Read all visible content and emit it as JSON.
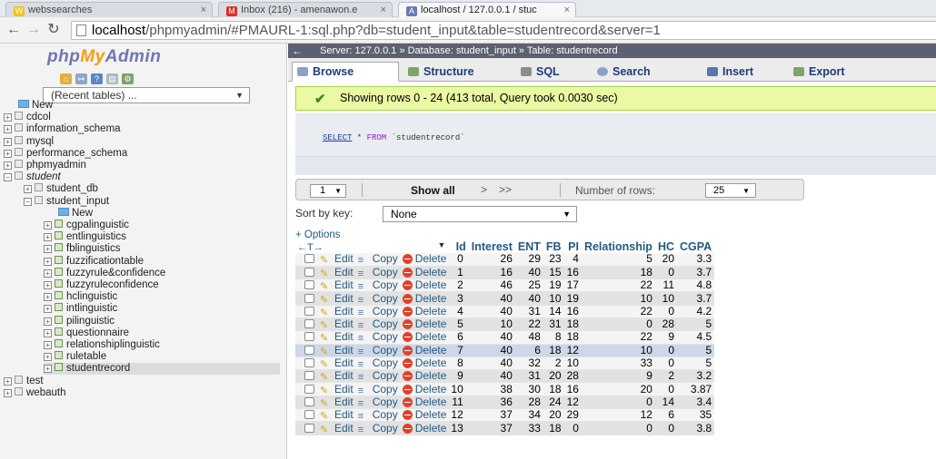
{
  "browser": {
    "tabs": [
      {
        "icon": "W",
        "icon_color": "#f2c417",
        "title": "webssearches"
      },
      {
        "icon": "M",
        "icon_color": "#d93025",
        "title": "Inbox (216) - amenawon.e"
      },
      {
        "icon": "A",
        "icon_color": "#6c78af",
        "title": "localhost / 127.0.0.1 / stuc"
      }
    ],
    "close_glyph": "×",
    "url_host": "localhost",
    "url_rest": "/phpmyadmin/#PMAURL-1:sql.php?db=student_input&table=studentrecord&server=1"
  },
  "sidebar": {
    "logo_php": "php",
    "logo_my": "My",
    "logo_admin": "Admin",
    "recent_tables": "(Recent tables) ...",
    "tree": [
      {
        "label": "New",
        "kind": "new",
        "level": 0
      },
      {
        "label": "cdcol",
        "kind": "db",
        "level": 0
      },
      {
        "label": "information_schema",
        "kind": "db",
        "level": 0
      },
      {
        "label": "mysql",
        "kind": "db",
        "level": 0
      },
      {
        "label": "performance_schema",
        "kind": "db",
        "level": 0
      },
      {
        "label": "phpmyadmin",
        "kind": "db",
        "level": 0
      },
      {
        "label": "student",
        "kind": "group",
        "level": 0
      },
      {
        "label": "student_db",
        "kind": "db",
        "level": 1
      },
      {
        "label": "student_input",
        "kind": "db",
        "level": 1
      },
      {
        "label": "New",
        "kind": "new",
        "level": 2
      },
      {
        "label": "cgpalinguistic",
        "kind": "table",
        "level": 2
      },
      {
        "label": "entlinguistics",
        "kind": "table",
        "level": 2
      },
      {
        "label": "fblinguistics",
        "kind": "table",
        "level": 2
      },
      {
        "label": "fuzzificationtable",
        "kind": "table",
        "level": 2
      },
      {
        "label": "fuzzyrule&confidence",
        "kind": "table",
        "level": 2
      },
      {
        "label": "fuzzyruleconfidence",
        "kind": "table",
        "level": 2
      },
      {
        "label": "hclinguistic",
        "kind": "table",
        "level": 2
      },
      {
        "label": "intlinguistic",
        "kind": "table",
        "level": 2
      },
      {
        "label": "pilinguistic",
        "kind": "table",
        "level": 2
      },
      {
        "label": "questionnaire",
        "kind": "table",
        "level": 2
      },
      {
        "label": "relationshiplinguistic",
        "kind": "table",
        "level": 2
      },
      {
        "label": "ruletable",
        "kind": "table",
        "level": 2
      },
      {
        "label": "studentrecord",
        "kind": "table",
        "level": 2,
        "selected": true
      },
      {
        "label": "test",
        "kind": "db",
        "level": 0
      },
      {
        "label": "webauth",
        "kind": "db",
        "level": 0
      }
    ]
  },
  "breadcrumb": {
    "back": "←",
    "text": "Server: 127.0.0.1 » Database: student_input » Table: studentrecord"
  },
  "tabs": [
    {
      "label": "Browse",
      "icon_color": "#8aa2c9",
      "active": true
    },
    {
      "label": "Structure",
      "icon_color": "#7fa36a"
    },
    {
      "label": "SQL",
      "icon_color": "#8c8c8c"
    },
    {
      "label": "Search",
      "icon_color": "#8aa2c9"
    },
    {
      "label": "Insert",
      "icon_color": "#5577aa"
    },
    {
      "label": "Export",
      "icon_color": "#7fa36a"
    }
  ],
  "message": {
    "check": "✔",
    "text": "Showing rows 0 - 24 (413 total, Query took 0.0030 sec)"
  },
  "query": {
    "select_kw": "SELECT",
    "star": " * ",
    "from_kw": "FROM",
    "table": " `studentrecord`"
  },
  "navigation": {
    "page": "1",
    "show_all": "Show all",
    "next": ">",
    "last": ">>",
    "rows_label": "Number of rows:",
    "rows_value": "25"
  },
  "sort": {
    "label": "Sort by key:",
    "value": "None"
  },
  "options_label": "+ Options",
  "resize_glyph": "←T→",
  "actions": {
    "edit": "Edit",
    "copy": "Copy",
    "delete": "Delete"
  },
  "table": {
    "columns": [
      "Id",
      "Interest",
      "ENT",
      "FB",
      "PI",
      "Relationship",
      "HC",
      "CGPA"
    ],
    "rows": [
      [
        "0",
        "26",
        "29",
        "23",
        "4",
        "5",
        "20",
        "3.3"
      ],
      [
        "1",
        "16",
        "40",
        "15",
        "16",
        "18",
        "0",
        "3.7"
      ],
      [
        "2",
        "46",
        "25",
        "19",
        "17",
        "22",
        "11",
        "4.8"
      ],
      [
        "3",
        "40",
        "40",
        "10",
        "19",
        "10",
        "10",
        "3.7"
      ],
      [
        "4",
        "40",
        "31",
        "14",
        "16",
        "22",
        "0",
        "4.2"
      ],
      [
        "5",
        "10",
        "22",
        "31",
        "18",
        "0",
        "28",
        "5"
      ],
      [
        "6",
        "40",
        "48",
        "8",
        "18",
        "22",
        "9",
        "4.5"
      ],
      [
        "7",
        "40",
        "6",
        "18",
        "12",
        "10",
        "0",
        "5"
      ],
      [
        "8",
        "40",
        "32",
        "2",
        "10",
        "33",
        "0",
        "5"
      ],
      [
        "9",
        "40",
        "31",
        "20",
        "28",
        "9",
        "2",
        "3.2"
      ],
      [
        "10",
        "38",
        "30",
        "18",
        "16",
        "20",
        "0",
        "3.87"
      ],
      [
        "11",
        "36",
        "28",
        "24",
        "12",
        "0",
        "14",
        "3.4"
      ],
      [
        "12",
        "37",
        "34",
        "20",
        "29",
        "12",
        "6",
        "35"
      ],
      [
        "13",
        "37",
        "33",
        "18",
        "0",
        "0",
        "0",
        "3.8"
      ]
    ],
    "highlighted_row": 7
  },
  "colors": {
    "accent": "#235a81",
    "success_bg": "#ebf8a4",
    "breadcrumb_bg": "#5c6071"
  }
}
